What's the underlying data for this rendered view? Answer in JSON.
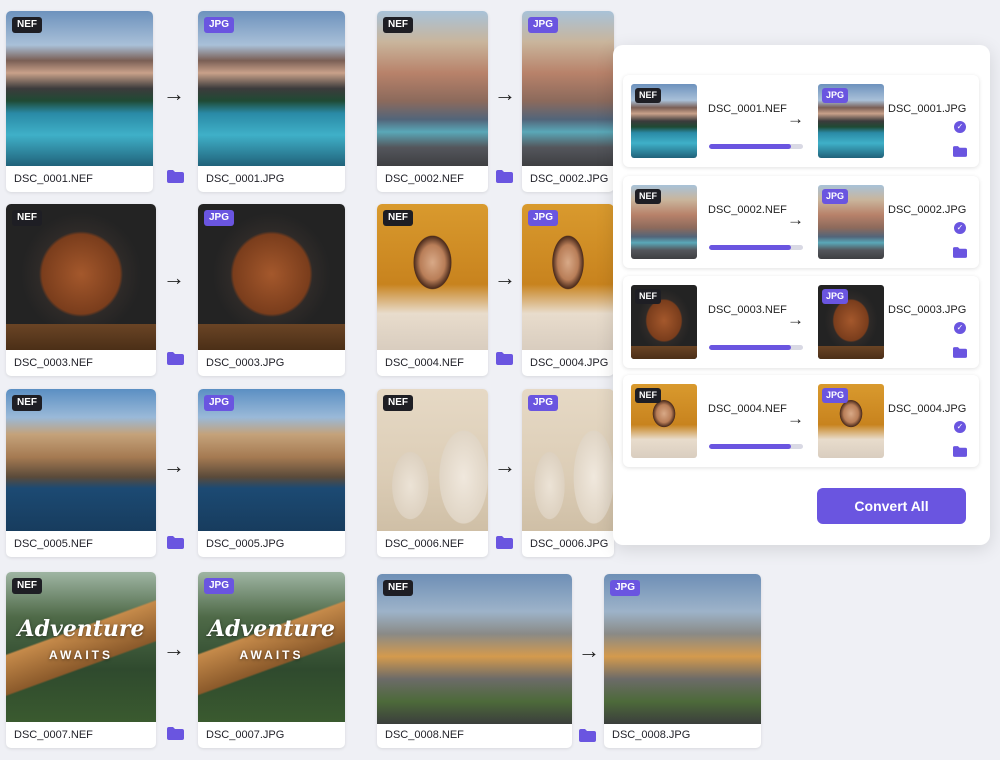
{
  "accent_color": "#6a55e0",
  "badges": {
    "nef": "NEF",
    "jpg": "JPG"
  },
  "files": [
    {
      "src": "DSC_0001.NEF",
      "dst": "DSC_0001.JPG"
    },
    {
      "src": "DSC_0002.NEF",
      "dst": "DSC_0002.JPG"
    },
    {
      "src": "DSC_0003.NEF",
      "dst": "DSC_0003.JPG"
    },
    {
      "src": "DSC_0004.NEF",
      "dst": "DSC_0004.JPG"
    },
    {
      "src": "DSC_0005.NEF",
      "dst": "DSC_0005.JPG"
    },
    {
      "src": "DSC_0006.NEF",
      "dst": "DSC_0006.JPG"
    },
    {
      "src": "DSC_0007.NEF",
      "dst": "DSC_0007.JPG"
    },
    {
      "src": "DSC_0008.NEF",
      "dst": "DSC_0008.JPG"
    }
  ],
  "cabin_image_text": {
    "line1": "Adventure",
    "line2": "AWAITS"
  },
  "panel": {
    "items": [
      {
        "src": "DSC_0001.NEF",
        "dst": "DSC_0001.JPG",
        "progress": 0.87,
        "status_icon": "check-circle-icon"
      },
      {
        "src": "DSC_0002.NEF",
        "dst": "DSC_0002.JPG",
        "progress": 0.87,
        "status_icon": "check-circle-icon"
      },
      {
        "src": "DSC_0003.NEF",
        "dst": "DSC_0003.JPG",
        "progress": 0.87,
        "status_icon": "check-circle-icon"
      },
      {
        "src": "DSC_0004.NEF",
        "dst": "DSC_0004.JPG",
        "progress": 0.87,
        "status_icon": "check-circle-icon"
      }
    ],
    "convert_all_label": "Convert All"
  },
  "icons": {
    "arrow": "arrow-right-icon",
    "folder": "folder-icon",
    "check": "check-circle-icon"
  }
}
